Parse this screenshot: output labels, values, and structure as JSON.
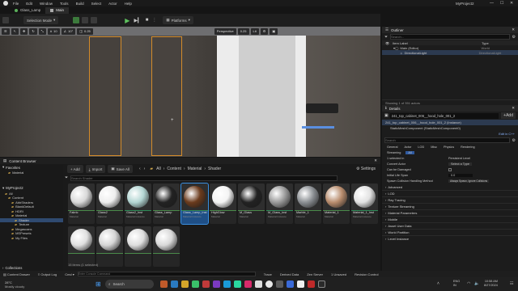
{
  "titlebar": {
    "project": "MyProject2",
    "menu": [
      "File",
      "Edit",
      "Window",
      "Tools",
      "Build",
      "Select",
      "Actor",
      "Help"
    ]
  },
  "tabs": [
    {
      "label": "Glass_Lamp"
    },
    {
      "label": "Main"
    }
  ],
  "toolbar": {
    "selection_mode": "Selection Mode",
    "platforms": "Platforms"
  },
  "viewport": {
    "perspective": "Perspective",
    "lit": "Lit",
    "snap": "0.25",
    "grid": "10",
    "angle": "10°",
    "scale": "0.25"
  },
  "outliner": {
    "title": "Outliner",
    "search_placeholder": "Search...",
    "col_label": "Item Label",
    "col_type": "Type",
    "rows": [
      {
        "label": "Main (Editor)",
        "type": "World"
      },
      {
        "label": "DirectionalLight",
        "type": "DirectionalLight"
      }
    ],
    "footer": "Showing 1 of 351 actors"
  },
  "details": {
    "title": "Details",
    "actor_name": "241_top_cabinet_006__hood_hole_001_2",
    "add_label": "+Add",
    "component": "241_top_cabinet_006__hood_hole_001_2 (Instance)",
    "component2": "StaticMeshComponent (StaticMeshComponent0)",
    "edit_cpp": "Edit in C++",
    "search_placeholder": "Search",
    "filter_tabs": [
      "General",
      "Actor",
      "LOD",
      "Misc",
      "Physics",
      "Rendering"
    ],
    "filter_tabs2": [
      "Streaming",
      "All"
    ],
    "props": [
      {
        "name": "1 selected in",
        "value": "Persistent Level"
      },
      {
        "name": "Convert Actor",
        "value": "Select a Type"
      },
      {
        "name": "Can be Damaged",
        "value": ""
      },
      {
        "name": "Initial Life Span",
        "value": "0.0"
      },
      {
        "name": "Spawn Collision Handling Method",
        "value": "Always Spawn, Ignore Collisions"
      }
    ],
    "sections": [
      "Advanced",
      "LOD",
      "Ray Tracing",
      "Texture Streaming",
      "Material Parameters",
      "Mobile",
      "Asset User Data",
      "World Partition",
      "Level Instance"
    ]
  },
  "content_browser": {
    "title": "Content Browser",
    "add": "+ Add",
    "import": "Import",
    "save_all": "Save All",
    "path": [
      "All",
      "Content",
      "Material",
      "Shader"
    ],
    "search_placeholder": "Search Shader",
    "favorites": "Favorites",
    "fav_item": "Material",
    "project": "MyProject2",
    "tree": [
      "All",
      "Content",
      "AbbShaders",
      "BlankDefault",
      "HDRI",
      "Material",
      "Shader",
      "Texture",
      "Megascans",
      "MSPresets",
      "My Files"
    ],
    "collections": "Collections",
    "items_label": "15 items (1 selected)",
    "assets": [
      {
        "name": "Fabric",
        "type": "Material",
        "color": "#d8d8d8"
      },
      {
        "name": "Glass2",
        "type": "Material",
        "color": "#eeeeee"
      },
      {
        "name": "Glass2_Inst",
        "type": "Material Instance",
        "color": "#b3d6d3"
      },
      {
        "name": "Glass_Lamp",
        "type": "Material",
        "color": "#222"
      },
      {
        "name": "Glass_Lamp_Inst",
        "type": "Material Instance",
        "color": "#6b3b1d"
      },
      {
        "name": "HighGlow",
        "type": "Material",
        "color": "#f4f4f4"
      },
      {
        "name": "M_Glass",
        "type": "Material",
        "color": "#222"
      },
      {
        "name": "M_Glass_Inst",
        "type": "Material Instance",
        "color": "#9a9a9a"
      },
      {
        "name": "Marble_1",
        "type": "Material",
        "color": "#8a8e92"
      },
      {
        "name": "Material_1",
        "type": "Material",
        "color": "#b88c6d"
      },
      {
        "name": "Material_1_Inst",
        "type": "Material Instance",
        "color": "#e2e2e2"
      },
      {
        "name": "",
        "type": "",
        "color": "#e0e0e0"
      },
      {
        "name": "",
        "type": "",
        "color": "#d5d5d5"
      },
      {
        "name": "",
        "type": "",
        "color": "#dedede"
      },
      {
        "name": "",
        "type": "",
        "color": "#d8d8d8"
      }
    ]
  },
  "statusbar": {
    "drawer": "Content Drawer",
    "output": "Output Log",
    "cmd": "Cmd",
    "console_placeholder": "Enter Console Command",
    "trace": "Trace",
    "derived": "Derived Data",
    "zen": "Zen Server",
    "unsaved": "1 Unsaved",
    "revision": "Revision Control"
  },
  "taskbar": {
    "weather_temp": "28°C",
    "weather_desc": "Mostly cloudy",
    "search": "Search",
    "lang": "ENG",
    "region": "IN",
    "time": "10:58 AM",
    "date": "8/27/2024"
  }
}
